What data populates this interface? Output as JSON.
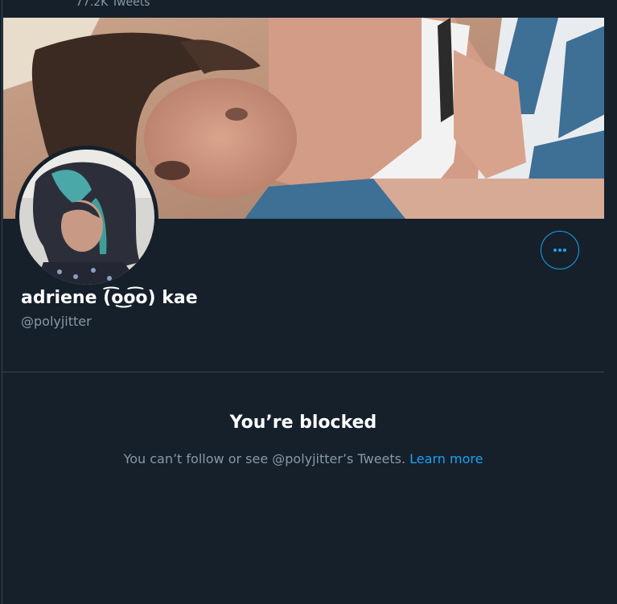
{
  "header": {
    "tweet_count": "77.2K Tweets"
  },
  "profile": {
    "display_name": "adriene (͡o͜o͡o) kae",
    "handle": "@polyjitter",
    "more_button_icon": "more-horizontal-icon"
  },
  "blocked": {
    "title": "You’re blocked",
    "message": "You can’t follow or see @polyjitter’s Tweets.",
    "learn_more": "Learn more"
  },
  "colors": {
    "background": "#15202b",
    "border": "#38444d",
    "accent": "#1da1f2",
    "secondary_text": "#8899a6",
    "primary_text": "#ffffff"
  }
}
